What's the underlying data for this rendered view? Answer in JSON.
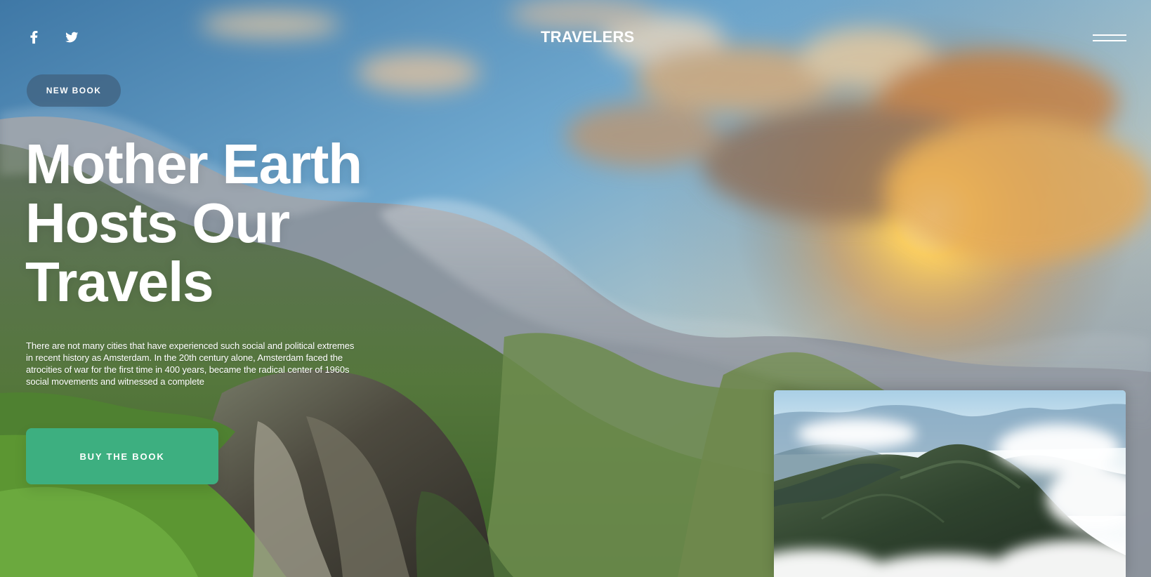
{
  "header": {
    "brand": "TRAVELERS",
    "social_icons": [
      "facebook-icon",
      "twitter-icon"
    ],
    "menu_icon": "hamburger-menu-icon"
  },
  "hero": {
    "badge": "NEW BOOK",
    "headline_lines": [
      "Mother Earth",
      "Hosts Our",
      "Travels"
    ],
    "description": "There are not many cities that have experienced such social and political extremes in recent history as Amsterdam. In the 20th century alone, Amsterdam faced the atrocities of war for the first time in 400 years, became the radical center of 1960s social movements and witnessed a complete",
    "cta": "BUY THE BOOK"
  },
  "colors": {
    "accent": "#3daf80",
    "badge": "#405f7d",
    "text": "#ffffff"
  }
}
